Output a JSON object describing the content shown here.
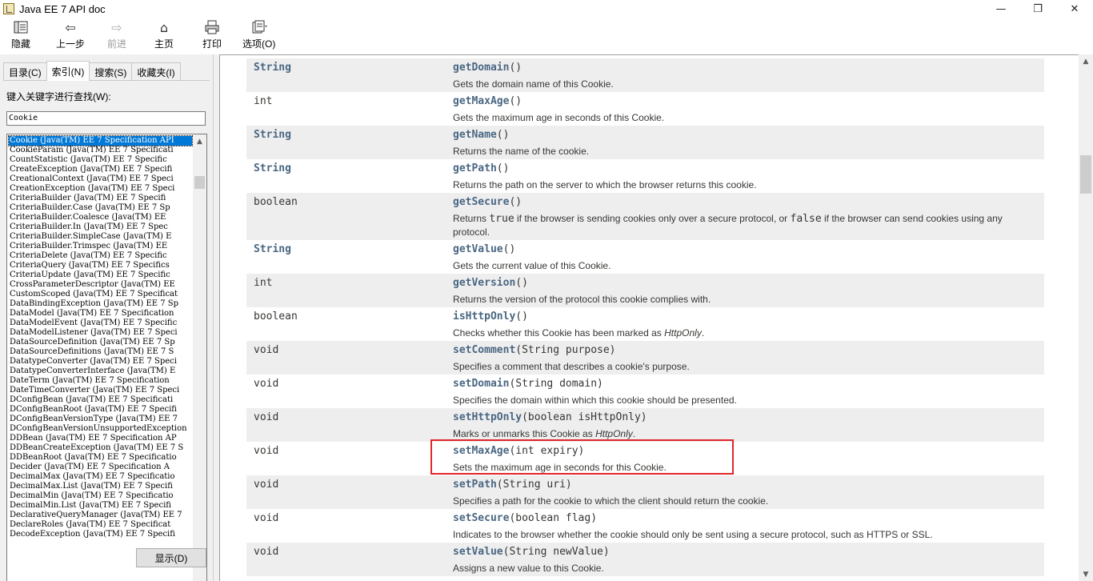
{
  "window": {
    "title": "Java EE 7 API doc",
    "minimize": "—",
    "restore": "❐",
    "close": "✕"
  },
  "toolbar": {
    "hide": "隐藏",
    "back": "上一步",
    "forward": "前进",
    "home": "主页",
    "print": "打印",
    "options": "选项(O)"
  },
  "nav": {
    "tabs": [
      "目录(C)",
      "索引(N)",
      "搜索(S)",
      "收藏夹(I)"
    ],
    "active_tab": 1,
    "prompt": "键入关键字进行查找(W):",
    "keyword": "Cookie",
    "show_button": "显示(D)",
    "scroll_up": "▲",
    "scroll_down": "▼",
    "selected_index": 0,
    "items": [
      "Cookie (Java(TM) EE 7 Specification API",
      "CookieParam (Java(TM) EE 7 Specificati",
      "CountStatistic (Java(TM) EE 7 Specific",
      "CreateException (Java(TM) EE 7 Specifi",
      "CreationalContext (Java(TM) EE 7 Speci",
      "CreationException (Java(TM) EE 7 Speci",
      "CriteriaBuilder (Java(TM) EE 7 Specifi",
      "CriteriaBuilder.Case (Java(TM) EE 7 Sp",
      "CriteriaBuilder.Coalesce (Java(TM) EE",
      "CriteriaBuilder.In (Java(TM) EE 7 Spec",
      "CriteriaBuilder.SimpleCase (Java(TM) E",
      "CriteriaBuilder.Trimspec (Java(TM) EE",
      "CriteriaDelete (Java(TM) EE 7 Specific",
      "CriteriaQuery (Java(TM) EE 7 Specifics",
      "CriteriaUpdate (Java(TM) EE 7 Specific",
      "CrossParameterDescriptor (Java(TM) EE",
      "CustomScoped (Java(TM) EE 7 Specificat",
      "DataBindingException (Java(TM) EE 7 Sp",
      "DataModel (Java(TM) EE 7 Specification",
      "DataModelEvent (Java(TM) EE 7 Specific",
      "DataModelListener (Java(TM) EE 7 Speci",
      "DataSourceDefinition (Java(TM) EE 7 Sp",
      "DataSourceDefinitions (Java(TM) EE 7 S",
      "DatatypeConverter (Java(TM) EE 7 Speci",
      "DatatypeConverterInterface (Java(TM) E",
      "DateTerm (Java(TM) EE 7 Specification",
      "DateTimeConverter (Java(TM) EE 7 Speci",
      "DConfigBean (Java(TM) EE 7 Specificati",
      "DConfigBeanRoot (Java(TM) EE 7 Specifi",
      "DConfigBeanVersionType (Java(TM) EE 7",
      "DConfigBeanVersionUnsupportedException",
      "DDBean (Java(TM) EE 7 Specification AP",
      "DDBeanCreateException (Java(TM) EE 7 S",
      "DDBeanRoot (Java(TM) EE 7 Specificatio",
      "Decider (Java(TM) EE 7 Specification A",
      "DecimalMax (Java(TM) EE 7 Specificatio",
      "DecimalMax.List (Java(TM) EE 7 Specifi",
      "DecimalMin (Java(TM) EE 7 Specificatio",
      "DecimalMin.List (Java(TM) EE 7 Specifi",
      "DeclarativeQueryManager (Java(TM) EE 7",
      "DeclareRoles (Java(TM) EE 7 Specificat",
      "DecodeException (Java(TM) EE 7 Specifi"
    ]
  },
  "methods": [
    {
      "type": "String",
      "type_link": true,
      "name": "getDomain",
      "params": "()",
      "desc": [
        "Gets the domain name of this Cookie."
      ]
    },
    {
      "type": "int",
      "type_link": false,
      "name": "getMaxAge",
      "params": "()",
      "desc": [
        "Gets the maximum age in seconds of this Cookie."
      ]
    },
    {
      "type": "String",
      "type_link": true,
      "name": "getName",
      "params": "()",
      "desc": [
        "Returns the name of the cookie."
      ]
    },
    {
      "type": "String",
      "type_link": true,
      "name": "getPath",
      "params": "()",
      "desc": [
        "Returns the path on the server to which the browser returns this cookie."
      ]
    },
    {
      "type": "boolean",
      "type_link": false,
      "name": "getSecure",
      "params": "()",
      "desc": [
        "Returns ",
        "true",
        " if the browser is sending cookies only over a secure protocol, or ",
        "false",
        " if the browser can send cookies using any protocol."
      ]
    },
    {
      "type": "String",
      "type_link": true,
      "name": "getValue",
      "params": "()",
      "desc": [
        "Gets the current value of this Cookie."
      ]
    },
    {
      "type": "int",
      "type_link": false,
      "name": "getVersion",
      "params": "()",
      "desc": [
        "Returns the version of the protocol this cookie complies with."
      ]
    },
    {
      "type": "boolean",
      "type_link": false,
      "name": "isHttpOnly",
      "params": "()",
      "desc": [
        "Checks whether this Cookie has been marked as ",
        "HttpOnly",
        "."
      ]
    },
    {
      "type": "void",
      "type_link": false,
      "name": "setComment",
      "params": "(String purpose)",
      "desc": [
        "Specifies a comment that describes a cookie's purpose."
      ]
    },
    {
      "type": "void",
      "type_link": false,
      "name": "setDomain",
      "params": "(String domain)",
      "desc": [
        "Specifies the domain within which this cookie should be presented."
      ]
    },
    {
      "type": "void",
      "type_link": false,
      "name": "setHttpOnly",
      "params": "(boolean isHttpOnly)",
      "desc": [
        "Marks or unmarks this Cookie as ",
        "HttpOnly",
        "."
      ]
    },
    {
      "type": "void",
      "type_link": false,
      "name": "setMaxAge",
      "params": "(int expiry)",
      "desc": [
        "Sets the maximum age in seconds for this Cookie."
      ]
    },
    {
      "type": "void",
      "type_link": false,
      "name": "setPath",
      "params": "(String uri)",
      "desc": [
        "Specifies a path for the cookie to which the client should return the cookie."
      ]
    },
    {
      "type": "void",
      "type_link": false,
      "name": "setSecure",
      "params": "(boolean flag)",
      "desc": [
        "Indicates to the browser whether the cookie should only be sent using a secure protocol, such as HTTPS or SSL."
      ]
    },
    {
      "type": "void",
      "type_link": false,
      "name": "setValue",
      "params": "(String newValue)",
      "desc": [
        "Assigns a new value to this Cookie."
      ]
    }
  ],
  "highlight_method": "setMaxAge",
  "colors": {
    "link": "#4a6782",
    "row_alt": "#eeeeef",
    "highlight_border": "#e0262c",
    "selection": "#0078d7"
  }
}
